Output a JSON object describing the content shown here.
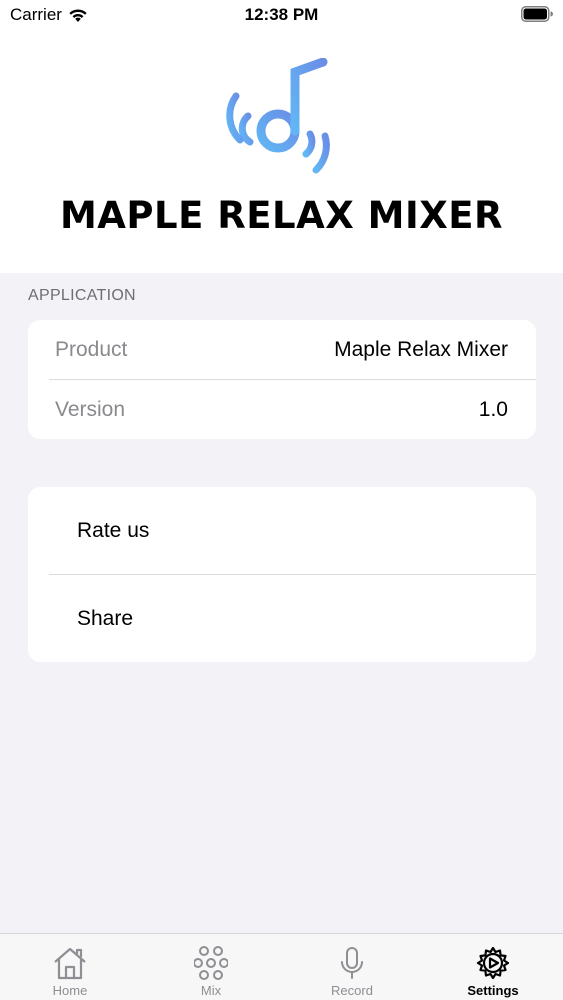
{
  "status_bar": {
    "carrier": "Carrier",
    "time": "12:38 PM"
  },
  "header": {
    "logo_icon": "music-note-signal-icon",
    "title": "MAPLE RELAX MIXER",
    "logo_colors": [
      "#62b6f5",
      "#6a8ee6"
    ]
  },
  "application_section": {
    "header": "APPLICATION",
    "rows": [
      {
        "key": "Product",
        "value": "Maple Relax Mixer"
      },
      {
        "key": "Version",
        "value": "1.0"
      }
    ]
  },
  "actions": [
    {
      "label": "Rate us"
    },
    {
      "label": "Share"
    }
  ],
  "tab_bar": {
    "tabs": [
      {
        "label": "Home",
        "icon": "house-icon",
        "active": false
      },
      {
        "label": "Mix",
        "icon": "circles-grid-icon",
        "active": false
      },
      {
        "label": "Record",
        "icon": "microphone-icon",
        "active": false
      },
      {
        "label": "Settings",
        "icon": "gear-play-icon",
        "active": true
      }
    ]
  }
}
